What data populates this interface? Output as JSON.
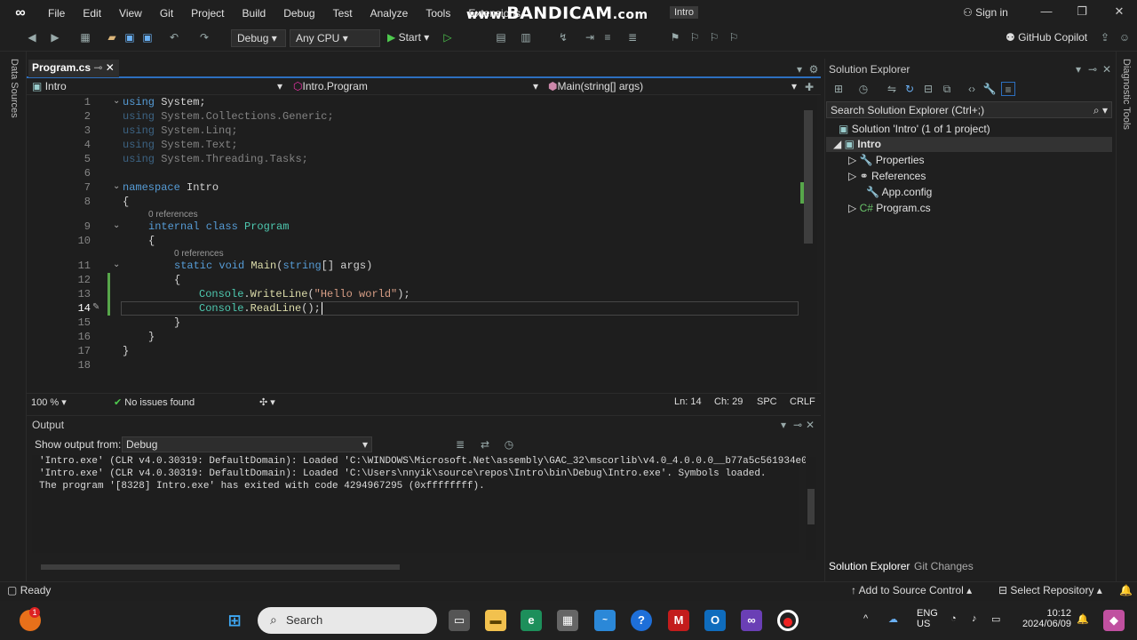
{
  "menu": [
    "File",
    "Edit",
    "View",
    "Git",
    "Project",
    "Build",
    "Debug",
    "Test",
    "Analyze",
    "Tools",
    "Extensions"
  ],
  "watermark": {
    "prefix": "www.",
    "brand": "BANDICAM",
    ".com": ".com"
  },
  "solution_title": "Intro",
  "sign_in": "Sign in",
  "toolbar": {
    "config": "Debug",
    "platform": "Any CPU",
    "start": "Start",
    "copilot": "GitHub Copilot"
  },
  "side_left": "Data Sources",
  "side_right": "Diagnostic Tools",
  "editor_tab": "Program.cs",
  "nav": {
    "project": "Intro",
    "class": "Intro.Program",
    "member": "Main(string[] args)"
  },
  "line_numbers": [
    "1",
    "2",
    "3",
    "4",
    "5",
    "6",
    "7",
    "8",
    "9",
    "10",
    "11",
    "12",
    "13",
    "14",
    "15",
    "16",
    "17",
    "18"
  ],
  "code": {
    "l1_kw": "using",
    "l1_rest": " System;",
    "l2_kw": "using",
    "l2_rest": " System.Collections.Generic;",
    "l3_kw": "using",
    "l3_rest": " System.Linq;",
    "l4_kw": "using",
    "l4_rest": " System.Text;",
    "l5_kw": "using",
    "l5_rest": " System.Threading.Tasks;",
    "l7_kw": "namespace",
    "l7_rest": " Intro",
    "l8": "{",
    "refs1": "0 references",
    "l9_kw": "internal class",
    "l9_type": " Program",
    "l10": "{",
    "refs2": "0 references",
    "l11_kw": "static void",
    "l11_fn": " Main",
    "l11_p1": "(",
    "l11_kw2": "string",
    "l11_rest": "[] args)",
    "l12": "{",
    "l13_type": "Console",
    "l13_dot": ".",
    "l13_fn": "WriteLine",
    "l13_p": "(",
    "l13_str": "\"Hello world\"",
    "l13_end": ");",
    "l14_type": "Console",
    "l14_dot": ".",
    "l14_fn": "ReadLine",
    "l14_end": "();",
    "l15": "}",
    "l16": "}",
    "l17": "}"
  },
  "editor_status": {
    "zoom": "100 %",
    "issues": "No issues found",
    "ln": "Ln: 14",
    "ch": "Ch: 29",
    "spc": "SPC",
    "crlf": "CRLF"
  },
  "output": {
    "title": "Output",
    "show_from_label": "Show output from:",
    "source": "Debug",
    "lines": [
      "'Intro.exe' (CLR v4.0.30319: DefaultDomain): Loaded 'C:\\WINDOWS\\Microsoft.Net\\assembly\\GAC_32\\mscorlib\\v4.0_4.0.0.0__b77a5c561934e0",
      "'Intro.exe' (CLR v4.0.30319: DefaultDomain): Loaded 'C:\\Users\\nnyik\\source\\repos\\Intro\\bin\\Debug\\Intro.exe'. Symbols loaded.",
      "The program '[8328] Intro.exe' has exited with code 4294967295 (0xffffffff)."
    ]
  },
  "solution_explorer": {
    "title": "Solution Explorer",
    "search": "Search Solution Explorer (Ctrl+;)",
    "solution": "Solution 'Intro' (1 of 1 project)",
    "project": "Intro",
    "items": [
      "Properties",
      "References",
      "App.config",
      "Program.cs"
    ],
    "tabs": [
      "Solution Explorer",
      "Git Changes"
    ]
  },
  "statusbar": {
    "ready": "Ready",
    "add_source": "Add to Source Control",
    "select_repo": "Select Repository"
  },
  "taskbar": {
    "search": "Search",
    "lang1": "ENG",
    "lang2": "US",
    "time": "10:12",
    "date": "2024/06/09",
    "badge": "1"
  },
  "colors": {
    "keyword": "#569cd6",
    "type": "#4ec9b0",
    "method": "#dcdcaa",
    "string": "#d69d85",
    "accent": "#2d6fbf"
  }
}
